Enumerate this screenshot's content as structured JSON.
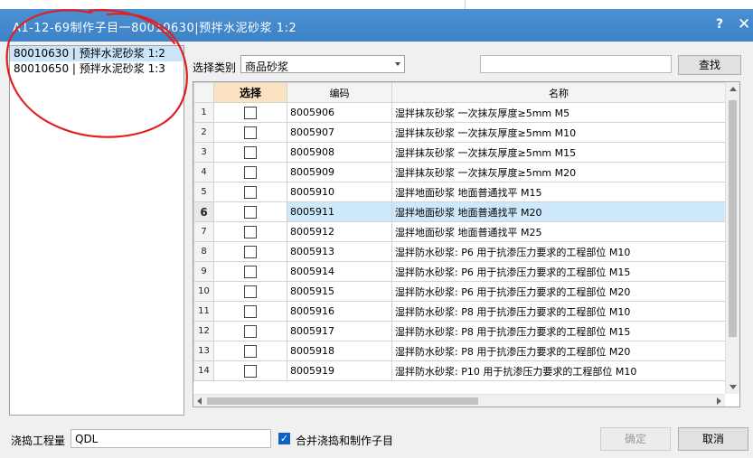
{
  "window": {
    "title": "A1-12-69制作子目一80010630|预拌水泥砂浆 1:2",
    "help_label": "?",
    "close_label": "✕"
  },
  "left_list": {
    "items": [
      {
        "label": "80010630 | 预拌水泥砂浆 1:2",
        "selected": true
      },
      {
        "label": "80010650 | 预拌水泥砂浆 1:3",
        "selected": false
      }
    ]
  },
  "filter": {
    "category_label": "选择类别",
    "category_value": "商品砂浆",
    "search_value": "",
    "search_button": "查找"
  },
  "grid": {
    "columns": [
      "",
      "选择",
      "编码",
      "名称"
    ],
    "selected_row": 6,
    "rows": [
      {
        "num": "1",
        "code": "8005906",
        "name": "湿拌抹灰砂浆 一次抹灰厚度≥5mm M5"
      },
      {
        "num": "2",
        "code": "8005907",
        "name": "湿拌抹灰砂浆 一次抹灰厚度≥5mm M10"
      },
      {
        "num": "3",
        "code": "8005908",
        "name": "湿拌抹灰砂浆 一次抹灰厚度≥5mm M15"
      },
      {
        "num": "4",
        "code": "8005909",
        "name": "湿拌抹灰砂浆 一次抹灰厚度≥5mm M20"
      },
      {
        "num": "5",
        "code": "8005910",
        "name": "湿拌地面砂浆 地面普通找平 M15"
      },
      {
        "num": "6",
        "code": "8005911",
        "name": "湿拌地面砂浆 地面普通找平 M20"
      },
      {
        "num": "7",
        "code": "8005912",
        "name": "湿拌地面砂浆 地面普通找平 M25"
      },
      {
        "num": "8",
        "code": "8005913",
        "name": "湿拌防水砂浆: P6 用于抗渗压力要求的工程部位 M10"
      },
      {
        "num": "9",
        "code": "8005914",
        "name": "湿拌防水砂浆: P6 用于抗渗压力要求的工程部位 M15"
      },
      {
        "num": "10",
        "code": "8005915",
        "name": "湿拌防水砂浆: P6 用于抗渗压力要求的工程部位 M20"
      },
      {
        "num": "11",
        "code": "8005916",
        "name": "湿拌防水砂浆: P8 用于抗渗压力要求的工程部位 M10"
      },
      {
        "num": "12",
        "code": "8005917",
        "name": "湿拌防水砂浆: P8 用于抗渗压力要求的工程部位 M15"
      },
      {
        "num": "13",
        "code": "8005918",
        "name": "湿拌防水砂浆: P8 用于抗渗压力要求的工程部位 M20"
      },
      {
        "num": "14",
        "code": "8005919",
        "name": "湿拌防水砂浆: P10 用于抗渗压力要求的工程部位 M10"
      }
    ]
  },
  "footer": {
    "quantity_label": "浇捣工程量",
    "quantity_value": "QDL",
    "merge_label": "合并浇捣和制作子目",
    "merge_checked": true,
    "ok_button": "确定",
    "cancel_button": "取消"
  },
  "colors": {
    "titlebar": "#3d82c7",
    "selection": "#cde8fa",
    "select_header": "#fbe3c2",
    "marker_red": "#e02020"
  }
}
